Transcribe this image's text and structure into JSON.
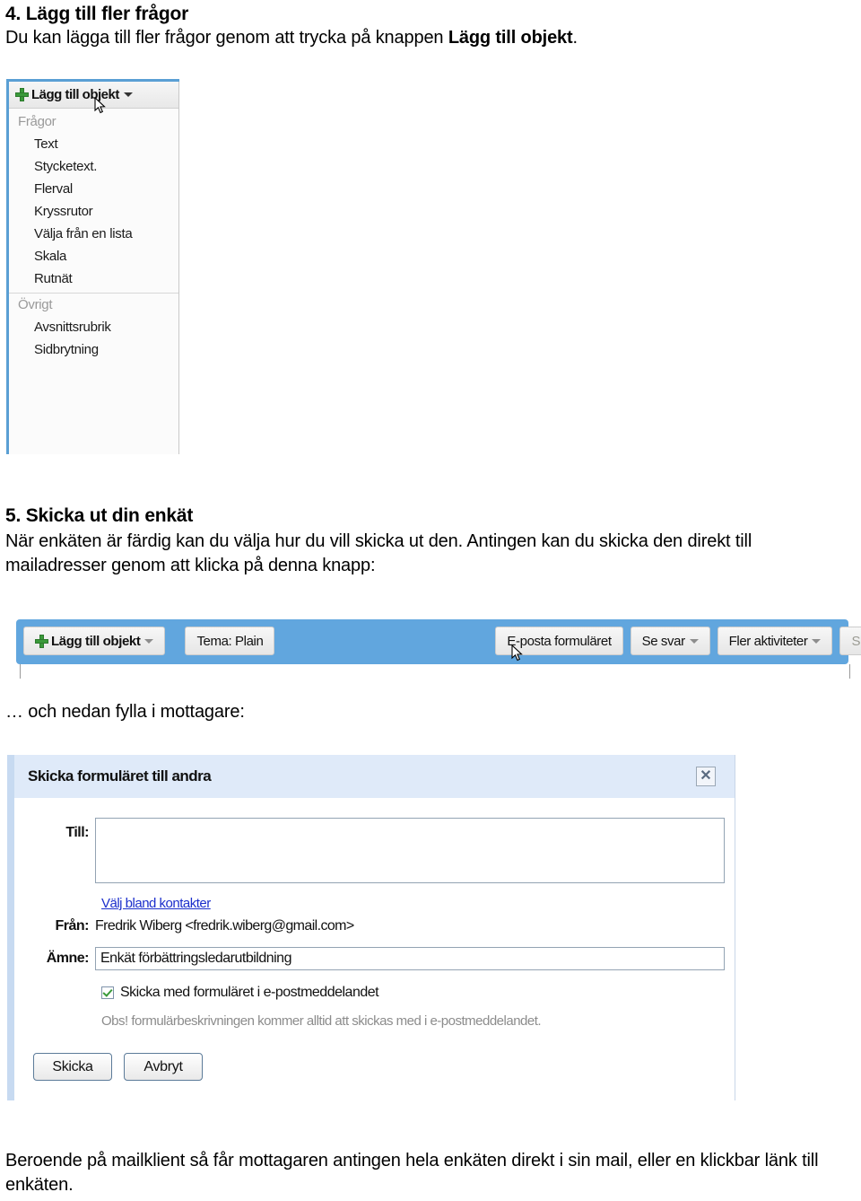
{
  "sections": {
    "four": {
      "heading": "4. Lägg till fler frågor",
      "para_before": "Du kan lägga till fler frågor genom att trycka på knappen ",
      "para_bold": "Lägg till objekt",
      "para_after": "."
    },
    "five": {
      "heading": "5. Skicka ut din enkät",
      "para": "När enkäten är färdig kan du välja hur du vill skicka ut den. Antingen kan du skicka den direkt till mailadresser genom att klicka på denna knapp:"
    },
    "mid_caption": "… och nedan fylla i mottagare:",
    "bottom_para": "Beroende på mailklient så får mottagaren antingen hela enkäten direkt i sin mail, eller en klickbar länk till enkäten."
  },
  "add_item_menu": {
    "button_label": "Lägg till objekt",
    "plus_icon": "plus-icon",
    "caret_icon": "chevron-down-icon",
    "cursor_icon": "mouse-pointer-icon",
    "groups": [
      {
        "label": "Frågor",
        "items": [
          "Text",
          "Stycketext.",
          "Flerval",
          "Kryssrutor",
          "Välja från en lista",
          "Skala",
          "Rutnät"
        ]
      },
      {
        "label": "Övrigt",
        "items": [
          "Avsnittsrubrik",
          "Sidbrytning"
        ]
      }
    ]
  },
  "toolbar": {
    "background_color": "#61a6de",
    "add_item_label": "Lägg till objekt",
    "theme_label": "Tema:  Plain",
    "email_form_label": "E-posta formuläret",
    "view_responses_label": "Se svar",
    "more_actions_label": "Fler aktiviteter",
    "saved_label": "Sparat",
    "cursor_icon": "mouse-pointer-icon"
  },
  "dialog": {
    "title": "Skicka formuläret till andra",
    "close_icon": "close-icon",
    "to_label": "Till:",
    "to_value": "",
    "to_placeholder": "",
    "contacts_link": "Välj bland kontakter",
    "from_label": "Från:",
    "from_value": "Fredrik Wiberg <fredrik.wiberg@gmail.com>",
    "subject_label": "Ämne:",
    "subject_value": "Enkät förbättringsledarutbildning",
    "checkbox_label": "Skicka med formuläret i e-postmeddelandet",
    "checkbox_checked": true,
    "note": "Obs! formulärbeskrivningen kommer alltid att skickas med i e-postmeddelandet.",
    "send_button": "Skicka",
    "cancel_button": "Avbryt",
    "accent_color": "#dfeaf9",
    "link_color": "#1b2ecc"
  }
}
